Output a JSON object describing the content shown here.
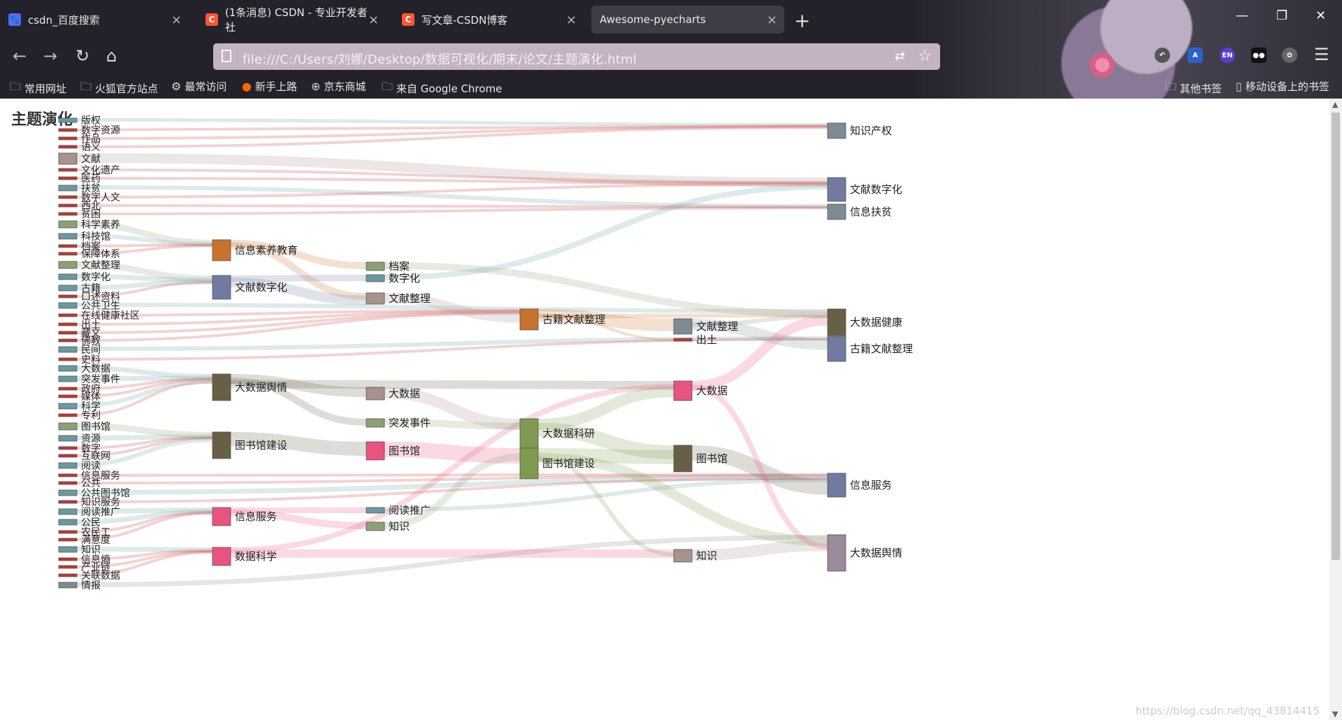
{
  "browser": {
    "tabs": [
      {
        "label": "csdn_百度搜索",
        "icon": "baidu-icon",
        "color": "#4e6ef2"
      },
      {
        "label": "(1条消息) CSDN - 专业开发者社",
        "icon": "csdn-icon",
        "color": "#fc5531"
      },
      {
        "label": "写文章-CSDN博客",
        "icon": "csdn-icon",
        "color": "#fc5531"
      },
      {
        "label": "Awesome-pyecharts",
        "icon": "",
        "color": ""
      }
    ],
    "url": "file:///C:/Users/刘娜/Desktop/数据可视化/期末/论文/主题演化.html",
    "bookmarks": [
      "常用网址",
      "火狐官方站点",
      "最常访问",
      "新手上路",
      "京东商城",
      "来自 Google Chrome"
    ],
    "bookmarks_right": [
      "其他书签",
      "移动设备上的书签"
    ]
  },
  "page": {
    "title": "主题演化",
    "watermark": "https://blog.csdn.net/qq_43814415"
  },
  "chart_data": {
    "type": "sankey",
    "title": "主题演化",
    "colors": {
      "teal": "#6a9aa1",
      "red": "#c23531",
      "orange": "#c7722e",
      "slate": "#717aa0",
      "brown": "#676047",
      "olive": "#7f9a4e",
      "pink": "#e8547f",
      "tan": "#a8928c",
      "gray": "#7e8b93",
      "mauve": "#9a8a9a",
      "sage": "#8ba173"
    },
    "nodes": [
      {
        "name": "版权",
        "col": 0,
        "color": "teal"
      },
      {
        "name": "数字资源",
        "col": 0,
        "color": "red"
      },
      {
        "name": "作品",
        "col": 0,
        "color": "red"
      },
      {
        "name": "语义",
        "col": 0,
        "color": "red"
      },
      {
        "name": "文献",
        "col": 0,
        "color": "tan"
      },
      {
        "name": "文化遗产",
        "col": 0,
        "color": "red"
      },
      {
        "name": "医药",
        "col": 0,
        "color": "red"
      },
      {
        "name": "扶贫",
        "col": 0,
        "color": "teal"
      },
      {
        "name": "数字人文",
        "col": 0,
        "color": "red"
      },
      {
        "name": "西北",
        "col": 0,
        "color": "red"
      },
      {
        "name": "贫困",
        "col": 0,
        "color": "red"
      },
      {
        "name": "科学素养",
        "col": 0,
        "color": "sage"
      },
      {
        "name": "科技馆",
        "col": 0,
        "color": "teal"
      },
      {
        "name": "档案",
        "col": 0,
        "color": "red"
      },
      {
        "name": "保障体系",
        "col": 0,
        "color": "red"
      },
      {
        "name": "文献整理",
        "col": 0,
        "color": "sage"
      },
      {
        "name": "数字化",
        "col": 0,
        "color": "teal"
      },
      {
        "name": "古籍",
        "col": 0,
        "color": "teal"
      },
      {
        "name": "口述资料",
        "col": 0,
        "color": "red"
      },
      {
        "name": "公共卫生",
        "col": 0,
        "color": "teal"
      },
      {
        "name": "在线健康社区",
        "col": 0,
        "color": "red"
      },
      {
        "name": "出土",
        "col": 0,
        "color": "red"
      },
      {
        "name": "藏文",
        "col": 0,
        "color": "red"
      },
      {
        "name": "佛教",
        "col": 0,
        "color": "red"
      },
      {
        "name": "民间",
        "col": 0,
        "color": "teal"
      },
      {
        "name": "史料",
        "col": 0,
        "color": "red"
      },
      {
        "name": "大数据",
        "col": 0,
        "color": "teal"
      },
      {
        "name": "突发事件",
        "col": 0,
        "color": "teal"
      },
      {
        "name": "政府",
        "col": 0,
        "color": "red"
      },
      {
        "name": "媒体",
        "col": 0,
        "color": "red"
      },
      {
        "name": "科学",
        "col": 0,
        "color": "teal"
      },
      {
        "name": "专利",
        "col": 0,
        "color": "red"
      },
      {
        "name": "图书馆",
        "col": 0,
        "color": "sage"
      },
      {
        "name": "资源",
        "col": 0,
        "color": "teal"
      },
      {
        "name": "数字",
        "col": 0,
        "color": "red"
      },
      {
        "name": "互联网",
        "col": 0,
        "color": "red"
      },
      {
        "name": "阅读",
        "col": 0,
        "color": "teal"
      },
      {
        "name": "信息服务",
        "col": 0,
        "color": "red"
      },
      {
        "name": "公共",
        "col": 0,
        "color": "red"
      },
      {
        "name": "公共图书馆",
        "col": 0,
        "color": "teal"
      },
      {
        "name": "知识服务",
        "col": 0,
        "color": "red"
      },
      {
        "name": "阅读推广",
        "col": 0,
        "color": "teal"
      },
      {
        "name": "公民",
        "col": 0,
        "color": "teal"
      },
      {
        "name": "农民工",
        "col": 0,
        "color": "red"
      },
      {
        "name": "满意度",
        "col": 0,
        "color": "red"
      },
      {
        "name": "知识",
        "col": 0,
        "color": "teal"
      },
      {
        "name": "信息熵",
        "col": 0,
        "color": "red"
      },
      {
        "name": "产业链",
        "col": 0,
        "color": "red"
      },
      {
        "name": "关联数据",
        "col": 0,
        "color": "red"
      },
      {
        "name": "情报",
        "col": 0,
        "color": "gray"
      },
      {
        "name": "信息素养教育",
        "col": 1,
        "color": "orange"
      },
      {
        "name": "文献数字化",
        "col": 1,
        "color": "slate"
      },
      {
        "name": "大数据舆情",
        "col": 1,
        "color": "brown"
      },
      {
        "name": "图书馆建设",
        "col": 1,
        "color": "brown"
      },
      {
        "name": "信息服务",
        "col": 1,
        "color": "pink"
      },
      {
        "name": "数据科学",
        "col": 1,
        "color": "pink"
      },
      {
        "name": "档案",
        "col": 2,
        "color": "sage"
      },
      {
        "name": "数字化",
        "col": 2,
        "color": "teal"
      },
      {
        "name": "文献整理",
        "col": 2,
        "color": "tan"
      },
      {
        "name": "大数据",
        "col": 2,
        "color": "tan"
      },
      {
        "name": "突发事件",
        "col": 2,
        "color": "sage"
      },
      {
        "name": "图书馆",
        "col": 2,
        "color": "pink"
      },
      {
        "name": "阅读推广",
        "col": 2,
        "color": "teal"
      },
      {
        "name": "知识",
        "col": 2,
        "color": "sage"
      },
      {
        "name": "古籍文献整理",
        "col": 3,
        "color": "orange"
      },
      {
        "name": "大数据科研",
        "col": 3,
        "color": "olive"
      },
      {
        "name": "图书馆建设",
        "col": 3,
        "color": "olive"
      },
      {
        "name": "文献整理",
        "col": 4,
        "color": "gray"
      },
      {
        "name": "出土",
        "col": 4,
        "color": "red"
      },
      {
        "name": "大数据",
        "col": 4,
        "color": "pink"
      },
      {
        "name": "图书馆",
        "col": 4,
        "color": "brown"
      },
      {
        "name": "知识",
        "col": 4,
        "color": "tan"
      },
      {
        "name": "知识产权",
        "col": 5,
        "color": "gray"
      },
      {
        "name": "文献数字化",
        "col": 5,
        "color": "slate"
      },
      {
        "name": "信息扶贫",
        "col": 5,
        "color": "gray"
      },
      {
        "name": "大数据健康",
        "col": 5,
        "color": "brown"
      },
      {
        "name": "古籍文献整理",
        "col": 5,
        "color": "slate"
      },
      {
        "name": "信息服务",
        "col": 5,
        "color": "slate"
      },
      {
        "name": "大数据舆情",
        "col": 5,
        "color": "mauve"
      }
    ]
  }
}
